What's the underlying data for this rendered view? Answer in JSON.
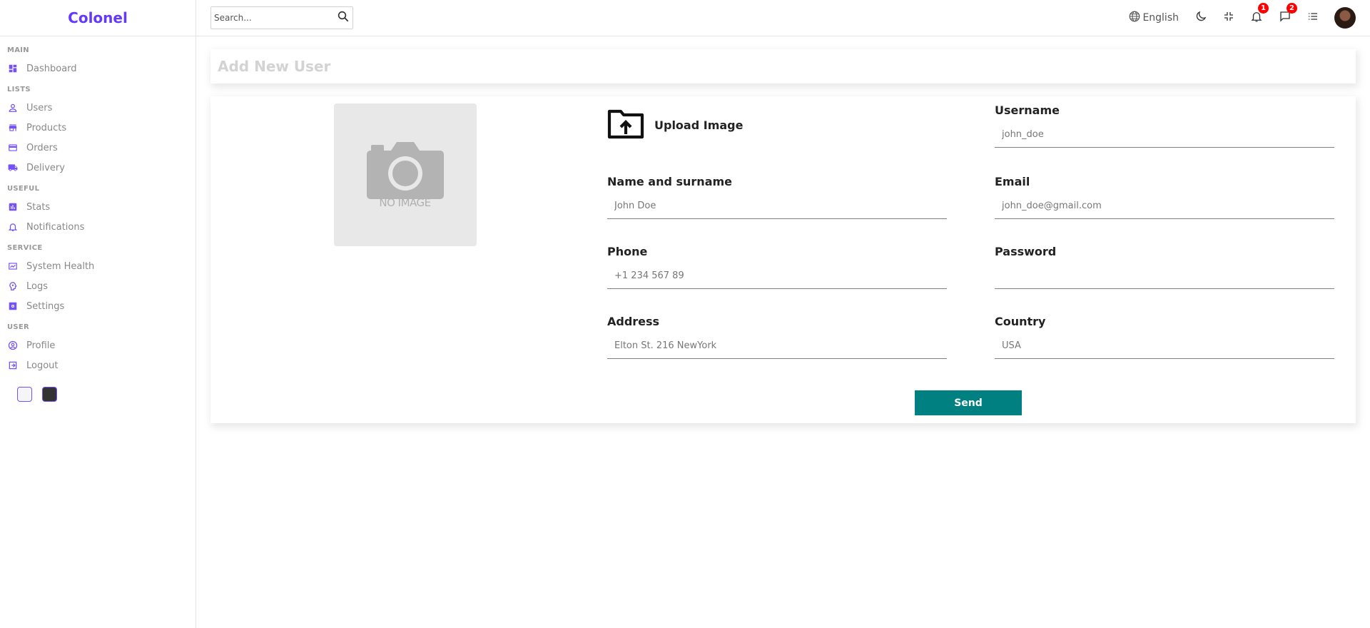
{
  "brand": {
    "name": "Colonel",
    "accent": "#6439ff"
  },
  "sidebar": {
    "sections": [
      {
        "title": "MAIN",
        "items": [
          {
            "label": "Dashboard",
            "icon": "dashboard-icon"
          }
        ]
      },
      {
        "title": "LISTS",
        "items": [
          {
            "label": "Users",
            "icon": "person-icon"
          },
          {
            "label": "Products",
            "icon": "store-icon"
          },
          {
            "label": "Orders",
            "icon": "credit-card-icon"
          },
          {
            "label": "Delivery",
            "icon": "truck-icon"
          }
        ]
      },
      {
        "title": "USEFUL",
        "items": [
          {
            "label": "Stats",
            "icon": "chart-icon"
          },
          {
            "label": "Notifications",
            "icon": "bell-icon"
          }
        ]
      },
      {
        "title": "SERVICE",
        "items": [
          {
            "label": "System Health",
            "icon": "health-icon"
          },
          {
            "label": "Logs",
            "icon": "psychology-icon"
          },
          {
            "label": "Settings",
            "icon": "settings-icon"
          }
        ]
      },
      {
        "title": "USER",
        "items": [
          {
            "label": "Profile",
            "icon": "account-circle-icon"
          },
          {
            "label": "Logout",
            "icon": "logout-icon"
          }
        ]
      }
    ],
    "theme_colors": {
      "light": "whitesmoke",
      "dark": "#333333"
    }
  },
  "navbar": {
    "search_placeholder": "Search...",
    "language": "English",
    "notifications_count": "1",
    "messages_count": "2"
  },
  "page": {
    "title": "Add New User",
    "upload_label": "Upload Image",
    "no_image_text": "NO IMAGE",
    "fields": [
      {
        "key": "username",
        "label": "Username",
        "placeholder": "john_doe"
      },
      {
        "key": "name",
        "label": "Name and surname",
        "placeholder": "John Doe"
      },
      {
        "key": "email",
        "label": "Email",
        "placeholder": "john_doe@gmail.com"
      },
      {
        "key": "phone",
        "label": "Phone",
        "placeholder": "+1 234 567 89"
      },
      {
        "key": "password",
        "label": "Password",
        "placeholder": ""
      },
      {
        "key": "address",
        "label": "Address",
        "placeholder": "Elton St. 216 NewYork"
      },
      {
        "key": "country",
        "label": "Country",
        "placeholder": "USA"
      }
    ],
    "send_label": "Send",
    "send_color": "#008080"
  }
}
